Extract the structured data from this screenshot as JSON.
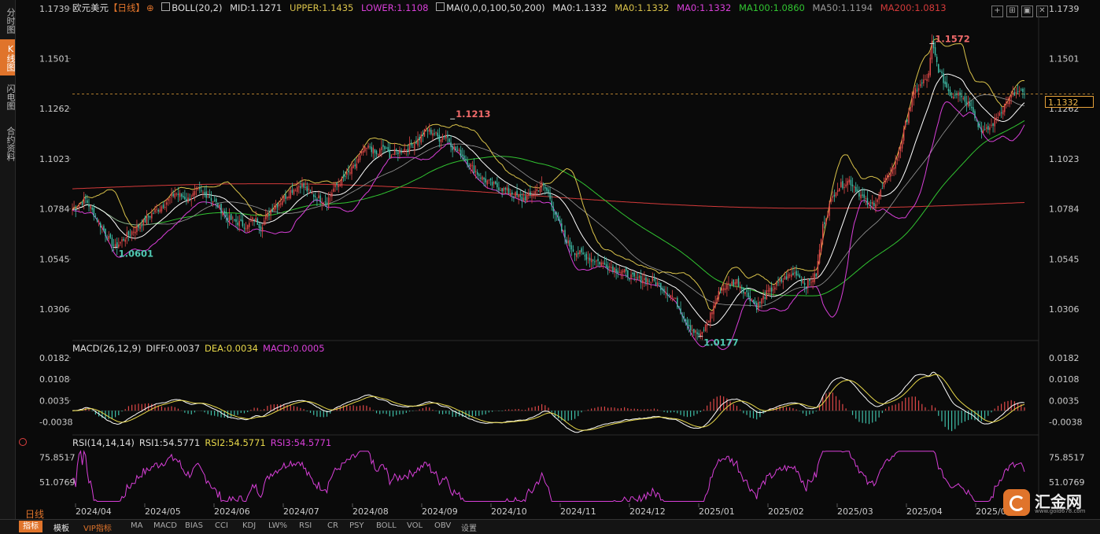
{
  "left_tabs": [
    {
      "label": "分时图",
      "active": false
    },
    {
      "label": "K线图",
      "active": true
    },
    {
      "label": "闪电图",
      "active": false
    },
    {
      "label": "合约资料",
      "active": false
    }
  ],
  "legend": {
    "symbol": "欧元美元",
    "period_bracket": "【日线】",
    "boll": "BOLL(20,2)",
    "mid": "MID:1.1271",
    "upper": "UPPER:1.1435",
    "lower": "LOWER:1.1108",
    "ma": "MA(0,0,0,100,50,200)",
    "ma0a": "MA0:1.1332",
    "ma0b": "MA0:1.1332",
    "ma0c": "MA0:1.1332",
    "ma100": "MA100:1.0860",
    "ma50": "MA50:1.1194",
    "ma200": "MA200:1.0813"
  },
  "macd_legend": {
    "title": "MACD(26,12,9)",
    "diff": "DIFF:0.0037",
    "dea": "DEA:0.0034",
    "macd": "MACD:0.0005"
  },
  "rsi_legend": {
    "title": "RSI(14,14,14)",
    "rsi1": "RSI1:54.5771",
    "rsi2": "RSI2:54.5771",
    "rsi3": "RSI3:54.5771"
  },
  "colors": {
    "up": "#e04848",
    "down": "#3fbfa8",
    "upper": "#d9c24a",
    "mid": "#ffffff",
    "lower": "#d83fd8",
    "ma100": "#31c431",
    "ma50": "#9a9a9a",
    "ma200": "#d43a3a",
    "diff": "#ffffff",
    "dea": "#e8d84a",
    "rsi": "#d83fd8",
    "accent": "#e0742b"
  },
  "current_price": "1.1332",
  "chart_data": {
    "type": "candlestick",
    "price_axis_ticks": [
      "1.1739",
      "1.1501",
      "1.1262",
      "1.1023",
      "1.0784",
      "1.0545",
      "1.0306"
    ],
    "price_ylim": [
      1.0168,
      1.175
    ],
    "macd_axis_ticks": [
      "0.0182",
      "0.0108",
      "0.0035",
      "-0.0038"
    ],
    "macd_ylim": [
      -0.0075,
      0.0195
    ],
    "rsi_axis_ticks": [
      "75.8517",
      "51.0769"
    ],
    "x_axis_labels": [
      "2024/04",
      "2024/05",
      "2024/06",
      "2024/07",
      "2024/08",
      "2024/09",
      "2024/10",
      "2024/11",
      "2024/12",
      "2025/01",
      "2025/02",
      "2025/03",
      "2025/04",
      "2025/05"
    ],
    "annotations": [
      {
        "text": "1.0601",
        "kind": "low",
        "price": 1.0601
      },
      {
        "text": "1.1213",
        "kind": "high",
        "price": 1.1213
      },
      {
        "text": "1.0177",
        "kind": "low",
        "price": 1.0177
      },
      {
        "text": "1.1572",
        "kind": "high",
        "price": 1.1572
      }
    ],
    "close_path": [
      [
        0,
        1.078
      ],
      [
        8,
        1.083
      ],
      [
        16,
        1.072
      ],
      [
        22,
        1.064
      ],
      [
        26,
        1.0601
      ],
      [
        32,
        1.065
      ],
      [
        40,
        1.07
      ],
      [
        48,
        1.076
      ],
      [
        56,
        1.081
      ],
      [
        62,
        1.086
      ],
      [
        70,
        1.083
      ],
      [
        76,
        1.087
      ],
      [
        82,
        1.085
      ],
      [
        88,
        1.08
      ],
      [
        94,
        1.074
      ],
      [
        100,
        1.072
      ],
      [
        106,
        1.07
      ],
      [
        110,
        1.074
      ],
      [
        114,
        1.07
      ],
      [
        120,
        1.078
      ],
      [
        126,
        1.082
      ],
      [
        132,
        1.087
      ],
      [
        138,
        1.09
      ],
      [
        144,
        1.086
      ],
      [
        150,
        1.083
      ],
      [
        154,
        1.082
      ],
      [
        158,
        1.088
      ],
      [
        164,
        1.093
      ],
      [
        168,
        1.096
      ],
      [
        172,
        1.1
      ],
      [
        176,
        1.106
      ],
      [
        180,
        1.108
      ],
      [
        184,
        1.104
      ],
      [
        188,
        1.108
      ],
      [
        192,
        1.104
      ],
      [
        198,
        1.106
      ],
      [
        204,
        1.108
      ],
      [
        210,
        1.112
      ],
      [
        214,
        1.116
      ],
      [
        218,
        1.115
      ],
      [
        222,
        1.112
      ],
      [
        226,
        1.114
      ],
      [
        230,
        1.108
      ],
      [
        236,
        1.104
      ],
      [
        242,
        1.098
      ],
      [
        248,
        1.093
      ],
      [
        254,
        1.09
      ],
      [
        260,
        1.088
      ],
      [
        266,
        1.086
      ],
      [
        272,
        1.083
      ],
      [
        278,
        1.085
      ],
      [
        284,
        1.09
      ],
      [
        288,
        1.086
      ],
      [
        292,
        1.076
      ],
      [
        296,
        1.068
      ],
      [
        300,
        1.062
      ],
      [
        304,
        1.058
      ],
      [
        310,
        1.056
      ],
      [
        316,
        1.054
      ],
      [
        322,
        1.052
      ],
      [
        328,
        1.05
      ],
      [
        334,
        1.048
      ],
      [
        340,
        1.045
      ],
      [
        346,
        1.045
      ],
      [
        352,
        1.044
      ],
      [
        358,
        1.04
      ],
      [
        364,
        1.036
      ],
      [
        368,
        1.03
      ],
      [
        372,
        1.024
      ],
      [
        376,
        1.02
      ],
      [
        380,
        1.0177
      ],
      [
        384,
        1.024
      ],
      [
        388,
        1.032
      ],
      [
        392,
        1.04
      ],
      [
        396,
        1.042
      ],
      [
        402,
        1.044
      ],
      [
        408,
        1.038
      ],
      [
        414,
        1.032
      ],
      [
        420,
        1.038
      ],
      [
        426,
        1.042
      ],
      [
        432,
        1.046
      ],
      [
        438,
        1.048
      ],
      [
        444,
        1.042
      ],
      [
        450,
        1.047
      ],
      [
        454,
        1.07
      ],
      [
        458,
        1.08
      ],
      [
        462,
        1.088
      ],
      [
        466,
        1.09
      ],
      [
        470,
        1.092
      ],
      [
        474,
        1.088
      ],
      [
        478,
        1.084
      ],
      [
        482,
        1.08
      ],
      [
        486,
        1.082
      ],
      [
        490,
        1.088
      ],
      [
        494,
        1.095
      ],
      [
        498,
        1.1
      ],
      [
        502,
        1.112
      ],
      [
        506,
        1.125
      ],
      [
        510,
        1.135
      ],
      [
        514,
        1.138
      ],
      [
        518,
        1.142
      ],
      [
        520,
        1.1572
      ],
      [
        524,
        1.145
      ],
      [
        528,
        1.138
      ],
      [
        532,
        1.132
      ],
      [
        536,
        1.135
      ],
      [
        540,
        1.13
      ],
      [
        544,
        1.128
      ],
      [
        548,
        1.118
      ],
      [
        552,
        1.115
      ],
      [
        556,
        1.118
      ],
      [
        560,
        1.123
      ],
      [
        564,
        1.128
      ],
      [
        568,
        1.132
      ],
      [
        572,
        1.134
      ],
      [
        576,
        1.1332
      ]
    ]
  },
  "bottom_tabs": [
    "指标",
    "模板",
    "VIP指标",
    "MA",
    "MACD",
    "BIAS",
    "CCI",
    "KDJ",
    "LW%",
    "RSI",
    "CR",
    "PSY",
    "BOLL",
    "VOL",
    "OBV",
    "设置"
  ],
  "period_label": "日线",
  "logo": {
    "name": "汇金网",
    "url": "www.gold678.com"
  }
}
